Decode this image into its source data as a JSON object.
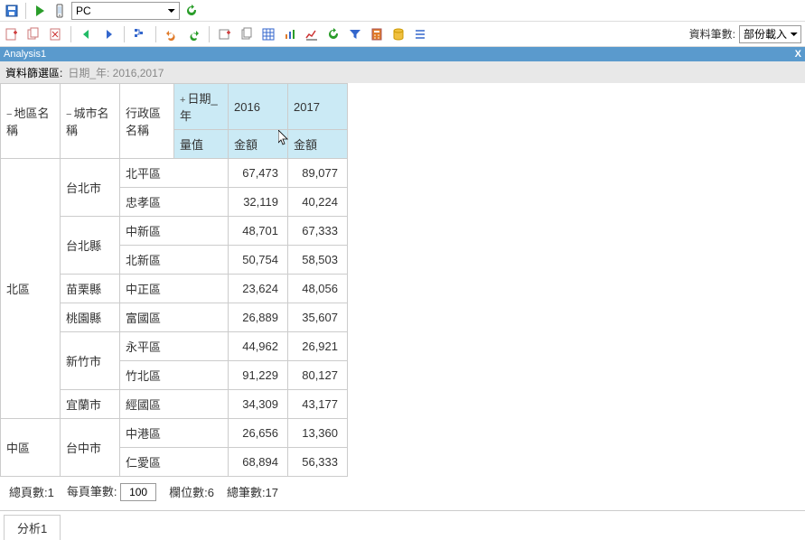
{
  "toolbar1": {
    "device_selected": "PC"
  },
  "toolbar2_right": {
    "label": "資料筆數:",
    "load_selected": "部份載入"
  },
  "titlebar": {
    "title": "Analysis1",
    "close": "X"
  },
  "filter": {
    "label": "資料篩選區:",
    "value": "日期_年: 2016,2017"
  },
  "headers": {
    "region": "地區名稱",
    "city": "城市名稱",
    "district": "行政區名稱",
    "date_year": "日期_年",
    "measure": "量值",
    "y2016": "2016",
    "y2017": "2017",
    "amount1": "金額",
    "amount2": "金額"
  },
  "rows": [
    {
      "region": "北區",
      "city": "台北市",
      "district": "北平區",
      "y2016": "67,473",
      "y2017": "89,077"
    },
    {
      "region": "",
      "city": "",
      "district": "忠孝區",
      "y2016": "32,119",
      "y2017": "40,224"
    },
    {
      "region": "",
      "city": "台北縣",
      "district": "中新區",
      "y2016": "48,701",
      "y2017": "67,333"
    },
    {
      "region": "",
      "city": "",
      "district": "北新區",
      "y2016": "50,754",
      "y2017": "58,503"
    },
    {
      "region": "",
      "city": "苗栗縣",
      "district": "中正區",
      "y2016": "23,624",
      "y2017": "48,056"
    },
    {
      "region": "",
      "city": "桃園縣",
      "district": "富國區",
      "y2016": "26,889",
      "y2017": "35,607"
    },
    {
      "region": "",
      "city": "新竹市",
      "district": "永平區",
      "y2016": "44,962",
      "y2017": "26,921"
    },
    {
      "region": "",
      "city": "",
      "district": "竹北區",
      "y2016": "91,229",
      "y2017": "80,127"
    },
    {
      "region": "",
      "city": "宜蘭市",
      "district": "經國區",
      "y2016": "34,309",
      "y2017": "43,177"
    },
    {
      "region": "中區",
      "city": "台中市",
      "district": "中港區",
      "y2016": "26,656",
      "y2017": "13,360"
    },
    {
      "region": "",
      "city": "",
      "district": "仁愛區",
      "y2016": "68,894",
      "y2017": "56,333"
    }
  ],
  "pager": {
    "total_pages_label": "總頁數:1",
    "per_page_label": "每頁筆數:",
    "per_page_value": "100",
    "col_count_label": "欄位數:6",
    "row_count_label": "總筆數:17"
  },
  "tab": {
    "label": "分析1"
  },
  "chart_data": {
    "type": "table",
    "title": "Analysis1",
    "filter": "日期_年: 2016,2017",
    "columns": [
      "地區名稱",
      "城市名稱",
      "行政區名稱",
      "2016 金額",
      "2017 金額"
    ],
    "data": [
      [
        "北區",
        "台北市",
        "北平區",
        67473,
        89077
      ],
      [
        "北區",
        "台北市",
        "忠孝區",
        32119,
        40224
      ],
      [
        "北區",
        "台北縣",
        "中新區",
        48701,
        67333
      ],
      [
        "北區",
        "台北縣",
        "北新區",
        50754,
        58503
      ],
      [
        "北區",
        "苗栗縣",
        "中正區",
        23624,
        48056
      ],
      [
        "北區",
        "桃園縣",
        "富國區",
        26889,
        35607
      ],
      [
        "北區",
        "新竹市",
        "永平區",
        44962,
        26921
      ],
      [
        "北區",
        "新竹市",
        "竹北區",
        91229,
        80127
      ],
      [
        "北區",
        "宜蘭市",
        "經國區",
        34309,
        43177
      ],
      [
        "中區",
        "台中市",
        "中港區",
        26656,
        13360
      ],
      [
        "中區",
        "台中市",
        "仁愛區",
        68894,
        56333
      ]
    ]
  }
}
